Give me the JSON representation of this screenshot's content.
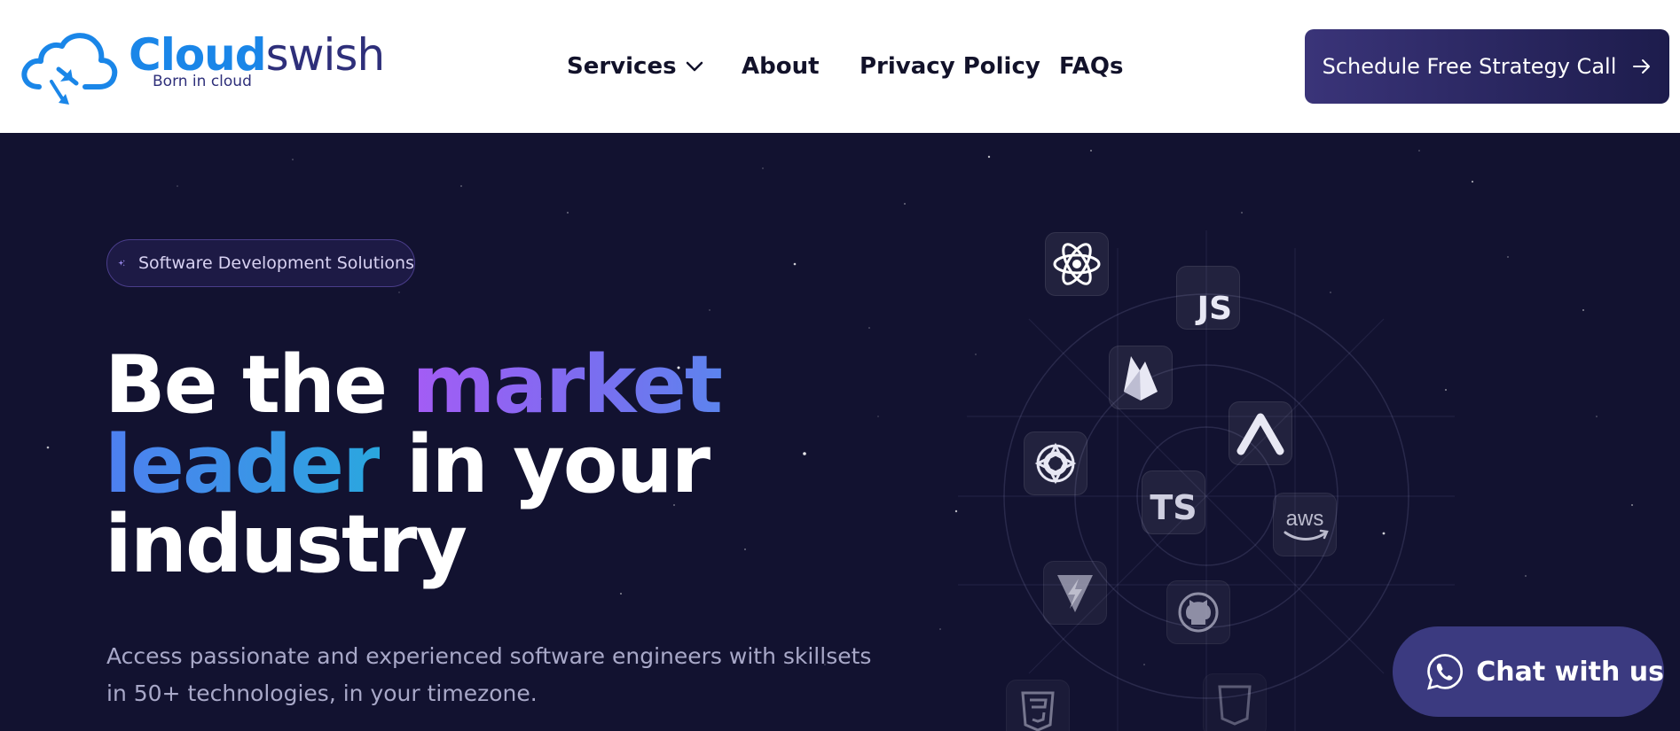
{
  "logo": {
    "brand_part1": "Cloud",
    "brand_part2": "swish",
    "tagline": "Born in cloud"
  },
  "nav": {
    "services": "Services",
    "about": "About",
    "privacy": "Privacy Policy",
    "faqs": "FAQs"
  },
  "cta": {
    "label": "Schedule Free Strategy Call"
  },
  "hero": {
    "badge": "Software Development Solutions",
    "headline": {
      "part1": "Be the ",
      "part2": "market",
      "part3": "leader",
      "part4": " in your",
      "part5": "industry"
    },
    "subtext": "Access passionate and experienced software engineers with skillsets in 50+ technologies, in your timezone."
  },
  "tech_tiles": {
    "js": "JS",
    "ts": "TS",
    "aws": "aws"
  },
  "chat": {
    "label": "Chat with us"
  },
  "icons": [
    "cloud-logo-icon",
    "chevron-down-icon",
    "arrow-right-icon",
    "sparkle-icon",
    "react-icon",
    "javascript-icon",
    "firebase-icon",
    "arc-icon",
    "openai-icon",
    "typescript-icon",
    "aws-icon",
    "vite-icon",
    "github-icon",
    "css3-icon",
    "html5-icon",
    "whatsapp-icon"
  ],
  "colors": {
    "brand_blue": "#1a86e8",
    "brand_navy": "#2e2f7a",
    "hero_bg": "#121230",
    "cta_bg": "#2a2763",
    "chat_bg": "#3b3a80"
  }
}
